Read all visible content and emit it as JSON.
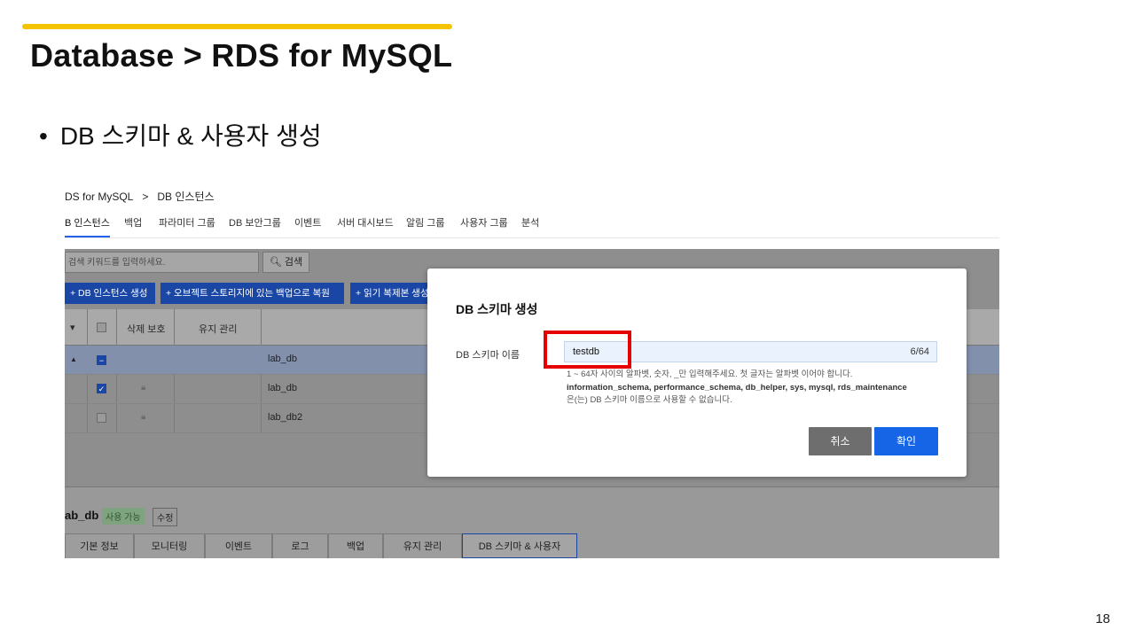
{
  "slide": {
    "title": "Database > RDS for MySQL",
    "bullet": "DB 스키마 & 사용자 생성",
    "page_number": "18",
    "accent_color": "#f5c400"
  },
  "console": {
    "breadcrumb": {
      "service": "DS for MySQL",
      "separator": ">",
      "current": "DB 인스턴스"
    },
    "tabs": [
      "B 인스턴스",
      "백업",
      "파라미터 그룹",
      "DB 보안그룹",
      "이벤트",
      "서버 대시보드",
      "알림 그룹",
      "사용자 그룹",
      "분석"
    ],
    "search": {
      "placeholder": "검색 키워드를 입력하세요.",
      "button_label": "검색"
    },
    "actions": [
      "+ DB 인스턴스 생성",
      "+ 오브젝트 스토리지에 있는 백업으로 복원",
      "+ 읽기 복제본 생성"
    ],
    "table": {
      "headers": {
        "delete_protect": "삭제 보호",
        "maintenance": "유지 관리"
      },
      "rows": [
        {
          "name": "lab_db",
          "expanded": true,
          "checked": "partial"
        },
        {
          "name": "lab_db",
          "checked": true,
          "locked": true
        },
        {
          "name": "lab_db2",
          "checked": false,
          "locked": true
        }
      ]
    },
    "detail": {
      "name": "ab_db",
      "status_badge": "사용 가능",
      "edit_label": "수정",
      "tabs": [
        "기본 정보",
        "모니터링",
        "이벤트",
        "로그",
        "백업",
        "유지 관리",
        "DB 스키마 & 사용자"
      ],
      "active_tab": "DB 스키마 & 사용자"
    }
  },
  "dialog": {
    "title": "DB 스키마 생성",
    "field_label": "DB 스키마 이름",
    "field_value": "testdb",
    "counter": "6/64",
    "help_line1": "1 ~ 64자 사이의 알파벳, 숫자, _만 입력해주세요. 첫 글자는 알파벳 이어야 합니다.",
    "help_reserved": "information_schema, performance_schema, db_helper, sys, mysql, rds_maintenance",
    "help_line3": "은(는) DB 스키마 이름으로 사용할 수 없습니다.",
    "cancel_label": "취소",
    "confirm_label": "확인",
    "highlight_color": "#e60000"
  }
}
